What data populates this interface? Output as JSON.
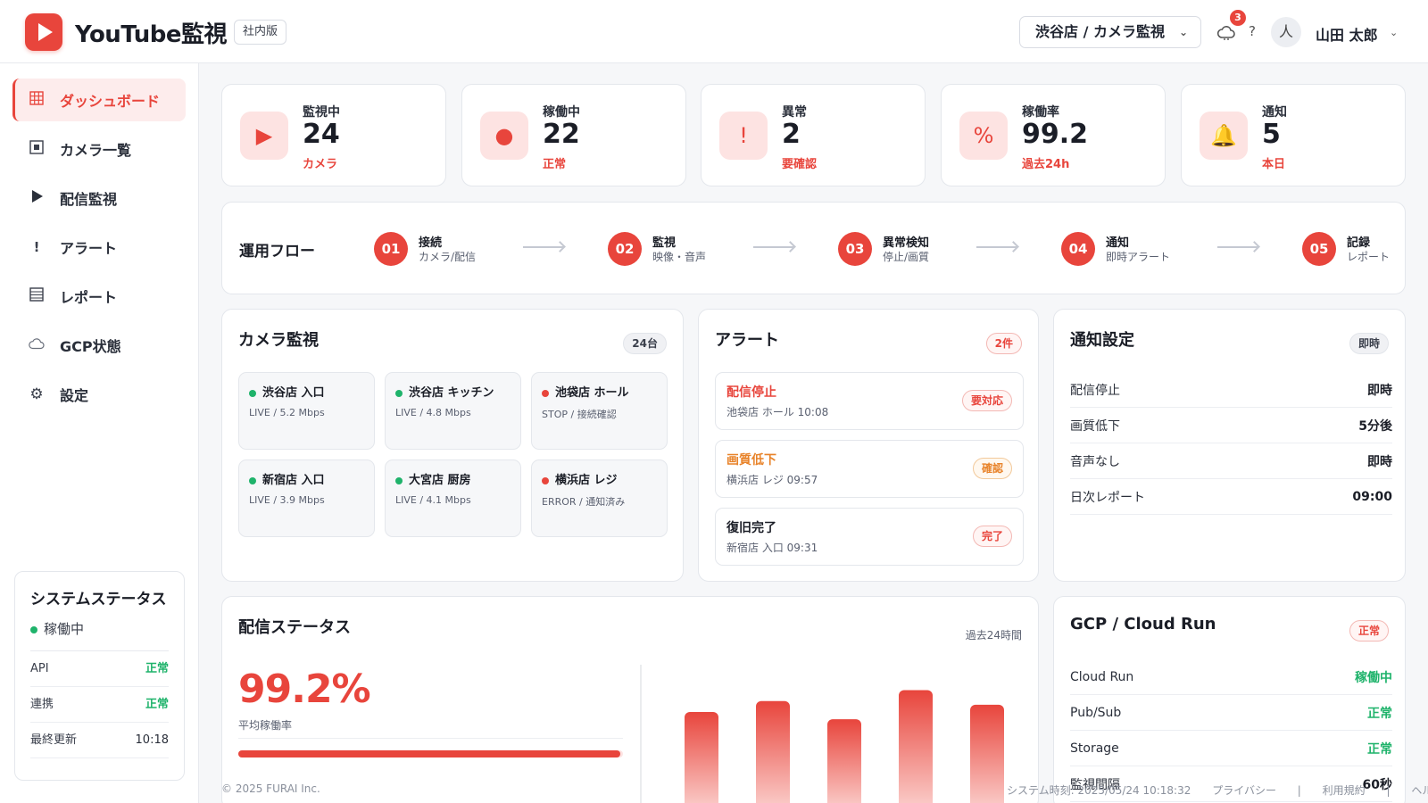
{
  "header": {
    "title": "YouTube監視",
    "edition_badge": "社内版",
    "store_select": "渋谷店 / カメラ監視",
    "notification_count": "3",
    "help": "?",
    "avatar": "人",
    "user_name": "山田 太郎"
  },
  "sidebar": {
    "items": [
      {
        "label": "ダッシュボード",
        "icon": "grid-icon"
      },
      {
        "label": "カメラ一覧",
        "icon": "camera-icon"
      },
      {
        "label": "配信監視",
        "icon": "play-icon"
      },
      {
        "label": "アラート",
        "icon": "exclamation-icon"
      },
      {
        "label": "レポート",
        "icon": "report-icon"
      },
      {
        "label": "GCP状態",
        "icon": "cloud-icon"
      },
      {
        "label": "設定",
        "icon": "gear-icon"
      }
    ],
    "system": {
      "title": "システムステータス",
      "state": "稼働中",
      "rows": [
        {
          "key": "API",
          "value": "正常"
        },
        {
          "key": "連携",
          "value": "正常"
        },
        {
          "key": "最終更新",
          "value": "10:18"
        }
      ]
    }
  },
  "stats": [
    {
      "label": "監視中",
      "value": "24",
      "sub": "カメラ",
      "icon": "▶"
    },
    {
      "label": "稼働中",
      "value": "22",
      "sub": "正常",
      "icon": "●"
    },
    {
      "label": "異常",
      "value": "2",
      "sub": "要確認",
      "icon": "!"
    },
    {
      "label": "稼働率",
      "value": "99.2",
      "sub": "過去24h",
      "icon": "%"
    },
    {
      "label": "通知",
      "value": "5",
      "sub": "本日",
      "icon": "🔔"
    }
  ],
  "flow": {
    "title": "運用フロー",
    "steps": [
      {
        "num": "01",
        "name": "接続",
        "desc": "カメラ/配信"
      },
      {
        "num": "02",
        "name": "監視",
        "desc": "映像・音声"
      },
      {
        "num": "03",
        "name": "異常検知",
        "desc": "停止/画質"
      },
      {
        "num": "04",
        "name": "通知",
        "desc": "即時アラート"
      },
      {
        "num": "05",
        "name": "記録",
        "desc": "レポート"
      }
    ]
  },
  "cameras": {
    "title": "カメラ監視",
    "count": "24台",
    "items": [
      {
        "name": "渋谷店 入口",
        "status": "LIVE / 5.2 Mbps",
        "state": "ok"
      },
      {
        "name": "渋谷店 キッチン",
        "status": "LIVE / 4.8 Mbps",
        "state": "ok"
      },
      {
        "name": "池袋店 ホール",
        "status": "STOP / 接続確認",
        "state": "error"
      },
      {
        "name": "新宿店 入口",
        "status": "LIVE / 3.9 Mbps",
        "state": "ok"
      },
      {
        "name": "大宮店 厨房",
        "status": "LIVE / 4.1 Mbps",
        "state": "ok"
      },
      {
        "name": "横浜店 レジ",
        "status": "ERROR / 通知済み",
        "state": "error"
      }
    ]
  },
  "alerts": {
    "title": "アラート",
    "count": "2件",
    "items": [
      {
        "title": "配信停止",
        "sub": "池袋店 ホール 10:08",
        "badge": "要対応",
        "color": "#e8453c"
      },
      {
        "title": "画質低下",
        "sub": "横浜店 レジ 09:57",
        "badge": "確認",
        "color": "#e8832a"
      },
      {
        "title": "復旧完了",
        "sub": "新宿店 入口 09:31",
        "badge": "完了",
        "color": "#1a1d26"
      }
    ]
  },
  "notify": {
    "title": "通知設定",
    "badge": "即時",
    "rows": [
      {
        "key": "配信停止",
        "value": "即時"
      },
      {
        "key": "画質低下",
        "value": "5分後"
      },
      {
        "key": "音声なし",
        "value": "即時"
      },
      {
        "key": "日次レポート",
        "value": "09:00"
      }
    ]
  },
  "stream": {
    "title": "配信ステータス",
    "range": "過去24時間",
    "percent": "99.2%",
    "percent_label": "平均稼働率",
    "progress": 0.992
  },
  "chart_data": {
    "type": "bar",
    "values": [
      27,
      30,
      25,
      33,
      29
    ],
    "ylim": [
      0,
      40
    ]
  },
  "gcp": {
    "title": "GCP / Cloud Run",
    "badge": "正常",
    "rows": [
      {
        "key": "Cloud Run",
        "value": "稼働中"
      },
      {
        "key": "Pub/Sub",
        "value": "正常"
      },
      {
        "key": "Storage",
        "value": "正常"
      },
      {
        "key": "監視間隔",
        "value": "60秒"
      }
    ]
  },
  "footer": {
    "copyright": "© 2025 FURAI Inc.",
    "system_time": "システム時刻: 2025/05/24 10:18:32",
    "privacy": "プライバシー",
    "terms": "利用規約",
    "help": "ヘルプ",
    "separator": "|"
  },
  "colors": {
    "accent": "#e8453c",
    "ok": "#1fb36b",
    "warn": "#e8832a"
  }
}
